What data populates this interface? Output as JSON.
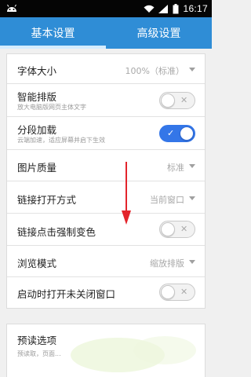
{
  "status_bar": {
    "time": "16:17",
    "icons": [
      "android-icon",
      "wifi-icon",
      "signal-icon",
      "battery-icon"
    ]
  },
  "tabs": [
    {
      "label": "基本设置",
      "active": true
    },
    {
      "label": "高级设置",
      "active": false
    }
  ],
  "settings": {
    "font_size": {
      "label": "字体大小",
      "value": "100%（标准）"
    },
    "smart_layout": {
      "label": "智能排版",
      "sub": "放大电脑版网页主体文字",
      "on": false
    },
    "segment_load": {
      "label": "分段加载",
      "sub": "云端加速，适应屏幕并启下生效",
      "on": true
    },
    "image_quality": {
      "label": "图片质量",
      "value": "标准"
    },
    "link_open": {
      "label": "链接打开方式",
      "value": "当前窗口"
    },
    "link_color": {
      "label": "链接点击强制变色",
      "on": false
    },
    "browse_mode": {
      "label": "浏览模式",
      "value": "缩放排版"
    },
    "restore_windows": {
      "label": "启动时打开未关闭窗口",
      "on": false
    }
  },
  "preload": {
    "label": "预读选项",
    "sub": "预读取，页面..."
  },
  "colors": {
    "header": "#2f8dd6",
    "toggle_on": "#3476e8",
    "arrow": "#e3242b"
  }
}
